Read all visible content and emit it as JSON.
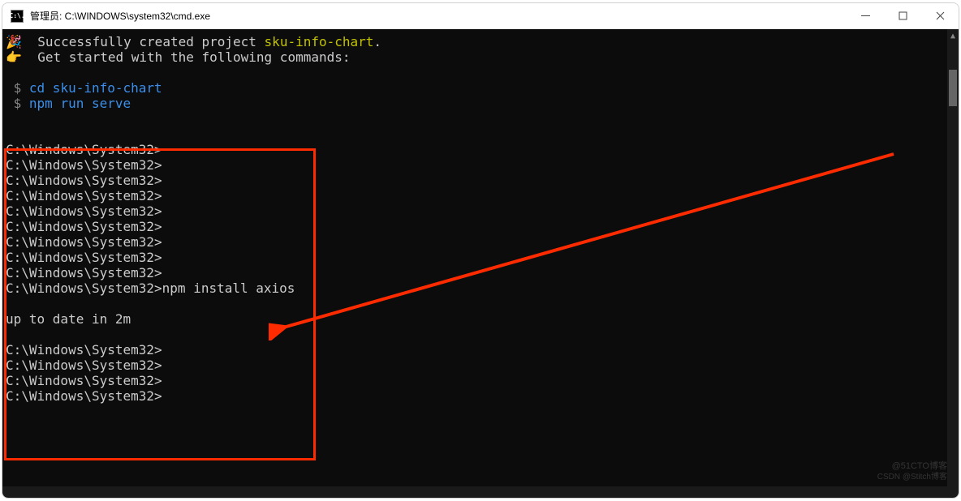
{
  "window": {
    "title": "管理员:  C:\\WINDOWS\\system32\\cmd.exe",
    "icon_label": "C:\\."
  },
  "colors": {
    "bg": "#0c0c0c",
    "text": "#cccccc",
    "yellow": "#c2c200",
    "blue": "#3b8eea",
    "highlight": "#ff2b00"
  },
  "lines": {
    "success_prefix": "  Successfully created project ",
    "project_name": "sku-info-chart",
    "success_suffix": ".",
    "get_started": "  Get started with the following commands:",
    "cmd1_dollar": " $ ",
    "cmd1": "cd sku-info-chart",
    "cmd2_dollar": " $ ",
    "cmd2": "npm run serve",
    "prompt": "C:\\Windows\\System32>",
    "install_cmd": "npm install axios",
    "uptodate": "up to date in 2m"
  },
  "icons": {
    "bullet1": "🎉",
    "bullet2": "👉"
  },
  "watermark": {
    "top": "@51CTO博客",
    "bottom": "CSDN @Stitch博客"
  }
}
